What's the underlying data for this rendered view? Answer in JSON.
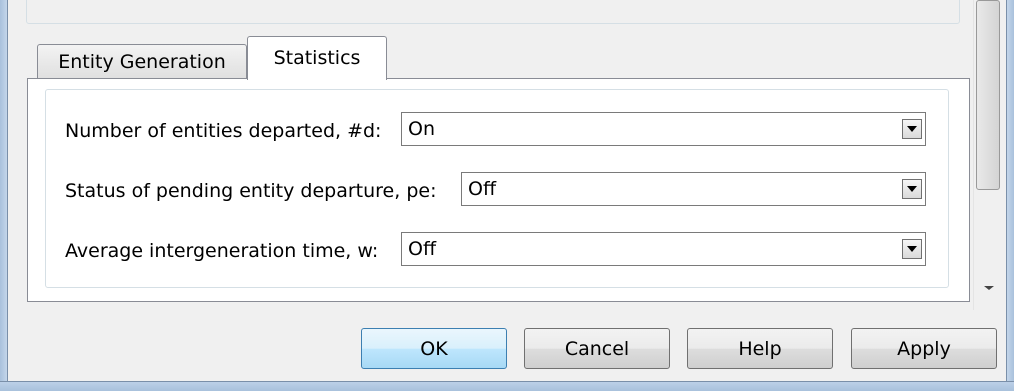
{
  "tabs": [
    {
      "label": "Entity Generation",
      "selected": false
    },
    {
      "label": "Statistics",
      "selected": true
    }
  ],
  "statistics": {
    "rows": [
      {
        "label": "Number of entities departed, #d:",
        "value": "On"
      },
      {
        "label": "Status of pending entity departure, pe:",
        "value": "Off"
      },
      {
        "label": "Average intergeneration time, w:",
        "value": "Off"
      }
    ]
  },
  "buttons": {
    "ok": "OK",
    "cancel": "Cancel",
    "help": "Help",
    "apply": "Apply"
  },
  "icons": {
    "dropdown": "chevron-down-icon",
    "scroll_down": "scroll-down-arrow-icon"
  },
  "colors": {
    "default_button_border": "#3c7fb1",
    "frame": "#a9c1dc"
  }
}
